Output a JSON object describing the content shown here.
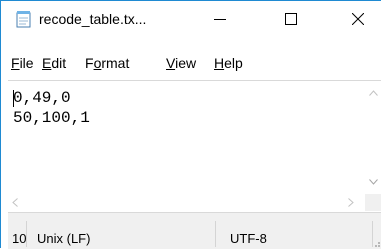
{
  "window": {
    "title": "recode_table.tx...",
    "minimize_glyph": "—",
    "maximize_glyph": "☐",
    "close_glyph": "✕",
    "accent_color": "#1f8ad2"
  },
  "menu": {
    "file": {
      "mnemonic": "F",
      "rest": "ile"
    },
    "edit": {
      "mnemonic": "E",
      "rest": "dit"
    },
    "format": {
      "pre": "F",
      "mnemonic": "o",
      "rest": "rmat"
    },
    "view": {
      "mnemonic": "V",
      "rest": "iew"
    },
    "help": {
      "mnemonic": "H",
      "rest": "elp"
    }
  },
  "editor": {
    "lines": [
      "0,49,0",
      "50,100,1"
    ]
  },
  "scrollbars": {
    "up": "^",
    "down": "v",
    "left": "<",
    "right": ">"
  },
  "status": {
    "position": "10",
    "line_ending": "Unix (LF)",
    "encoding": "UTF-8"
  },
  "icons": {
    "app": "notepad-icon",
    "grip": "resize-grip-icon"
  }
}
